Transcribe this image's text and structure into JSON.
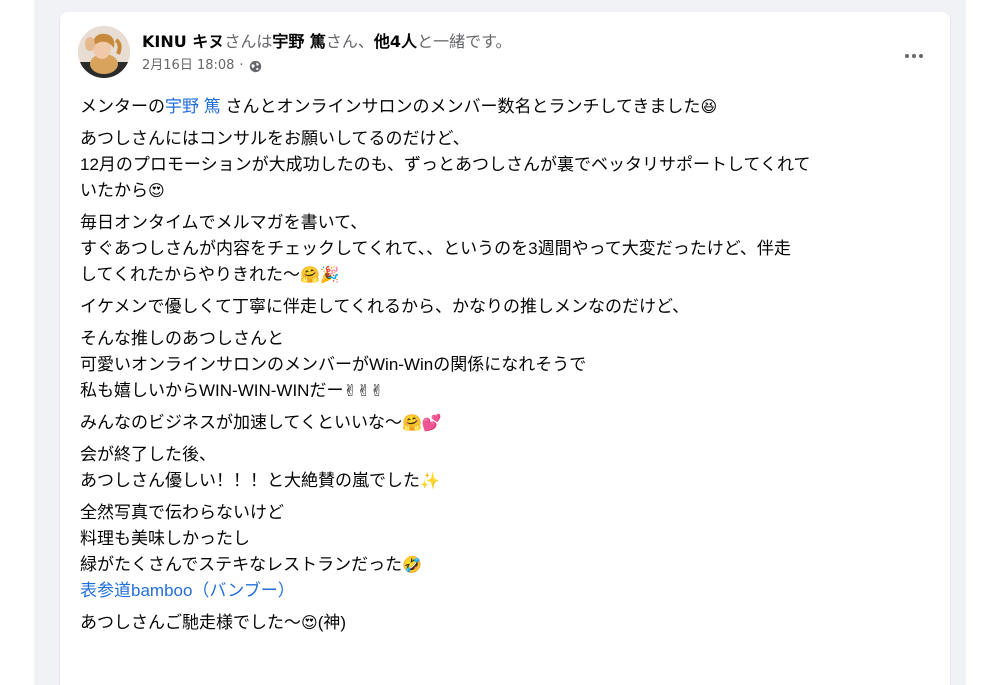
{
  "post": {
    "author": {
      "name": "KINU キヌ",
      "with_prefix": "さんは",
      "tagged": "宇野 篤",
      "tagged_suffix": "さん、",
      "others": "他4人",
      "together": "と一緒です。"
    },
    "timestamp": "2月16日 18:08",
    "separator": "·",
    "privacy_icon": "globe-icon",
    "more_icon": "more-horizontal-icon",
    "body": {
      "p1": {
        "pre": "メンターの",
        "mention": "宇野 篤",
        "post": " さんとオンラインサロンのメンバー数名とランチしてきました",
        "emoji": "😆"
      },
      "p2": {
        "l1": "あつしさんにはコンサルをお願いしてるのだけど、",
        "l2": "12月のプロモーションが大成功したのも、ずっとあつしさんが裏でベッタリサポートしてくれて",
        "l3": "いたから",
        "emoji": "😍"
      },
      "p3": {
        "l1": "毎日オンタイムでメルマガを書いて、",
        "l2": "すぐあつしさんが内容をチェックしてくれて、、というのを3週間やって大変だったけど、伴走",
        "l3": "してくれたからやりきれた〜",
        "emoji": "🤗🎉"
      },
      "p4": {
        "l1": "イケメンで優しくて丁寧に伴走してくれるから、かなりの推しメンなのだけど、"
      },
      "p5": {
        "l1": "そんな推しのあつしさんと",
        "l2": "可愛いオンラインサロンのメンバーがWin-Winの関係になれそうで",
        "l3": "私も嬉しいからWIN-WIN-WINだー",
        "emoji": "✌✌✌"
      },
      "p6": {
        "l1": "みんなのビジネスが加速してくといいな〜",
        "emoji": "🤗💕"
      },
      "p7": {
        "l1": "会が終了した後、",
        "l2": "あつしさん優しい！！！と大絶賛の嵐でした",
        "emoji": "✨"
      },
      "p8": {
        "l1": "全然写真で伝わらないけど",
        "l2": "料理も美味しかったし",
        "l3": "緑がたくさんでステキなレストランだった",
        "emoji": "🤣",
        "link": "表参道bamboo（バンブー）"
      },
      "p9": {
        "l1": "あつしさんご馳走様でした〜",
        "emoji": "😍",
        "l1_suffix": "(神)"
      }
    }
  }
}
